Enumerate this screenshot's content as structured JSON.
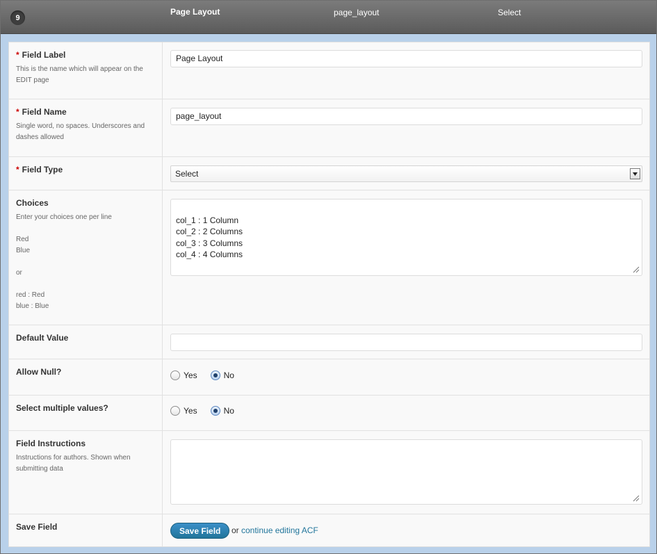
{
  "header": {
    "order_number": "9",
    "field_label": "Page Layout",
    "field_name": "page_layout",
    "field_type": "Select"
  },
  "rows": {
    "field_label": {
      "title": "Field Label",
      "help": "This is the name which will appear on the\nEDIT page",
      "value": "Page Layout"
    },
    "field_name": {
      "title": "Field Name",
      "help": "Single word, no spaces. Underscores and\ndashes allowed",
      "value": "page_layout"
    },
    "field_type": {
      "title": "Field Type",
      "selected": "Select"
    },
    "choices": {
      "title": "Choices",
      "help": "Enter your choices one per line\n\nRed\nBlue\n\nor\n\nred : Red\nblue : Blue",
      "value": "col_1 : 1 Column\ncol_2 : 2 Columns\ncol_3 : 3 Columns\ncol_4 : 4 Columns"
    },
    "default_value": {
      "title": "Default Value",
      "value": ""
    },
    "allow_null": {
      "title": "Allow Null?",
      "yes_label": "Yes",
      "no_label": "No",
      "selected": "No"
    },
    "multiple": {
      "title": "Select multiple values?",
      "yes_label": "Yes",
      "no_label": "No",
      "selected": "No"
    },
    "instructions": {
      "title": "Field Instructions",
      "help": "Instructions for authors. Shown when\nsubmitting data",
      "value": ""
    },
    "save": {
      "title": "Save Field",
      "button_label": "Save Field",
      "or_text": "or",
      "link_text": "continue editing ACF"
    }
  },
  "colors": {
    "accent": "#21759b",
    "required": "#cc0000",
    "header_bg": "#6b6b6b",
    "frame_bg": "#b9d1ea"
  }
}
